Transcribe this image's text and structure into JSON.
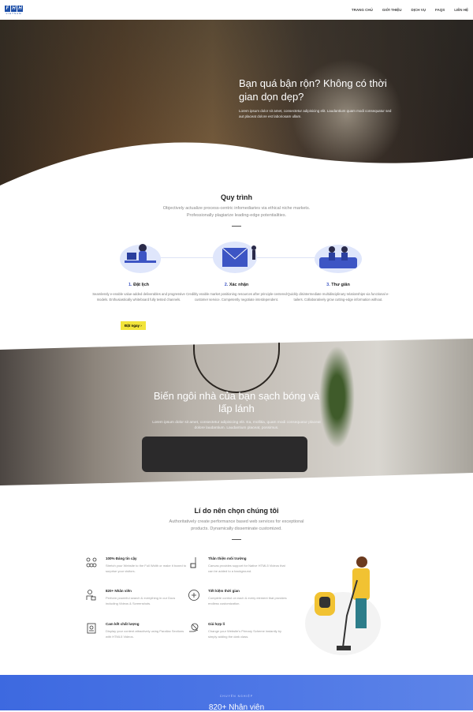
{
  "nav": {
    "logo_letters": [
      "F",
      "H",
      "H"
    ],
    "logo_sub": "VIETNAM",
    "items": [
      "TRANG CHỦ",
      "GIỚI THIỆU",
      "DỊCH VỤ",
      "FAQS",
      "LIÊN HỆ"
    ]
  },
  "hero": {
    "title": "Bạn quá bận rộn? Không có thời gian dọn dẹp?",
    "text": "Lorem ipsum dolor sit amet, consectetur adipisicing elit. Laudantium quam modi consequatur sed aut placeat dolore est laboriosam ullam."
  },
  "process": {
    "title": "Quy trình",
    "subtitle": "Objectively actualize process-centric infomediaries via ethical niche markets. Professionally plagiarize leading-edge potentialities.",
    "steps": [
      {
        "num": "1.",
        "label": "Đặt lịch",
        "text": "Seamlessly e-enable value-added deliverables and progressive models. Enthusiastically whiteboard fully tested channels."
      },
      {
        "num": "2.",
        "label": "Xác nhận",
        "text": "Credibly enable market positioning resources after principle-centered customer service. Competently negotiate interdependent."
      },
      {
        "num": "3.",
        "label": "Thư giãn",
        "text": "Quickly disintermediate multidisciplinary relationships via functional e-tailers. Collaboratively grow cutting-edge information without."
      }
    ],
    "button": "Đặt ngay"
  },
  "banner": {
    "title": "Biến ngôi nhà của bạn sạch bóng và lấp lánh",
    "text": "Lorem ipsum dolor sit amet, consectetur adipisicing elit. Ea, mollitia, quam modi consequatur placeat dolore laudantium. Laudantium placeat, possimus."
  },
  "reasons": {
    "title": "Lí do nên chọn chúng tôi",
    "subtitle": "Authoritatively create performance based web services for exceptional products. Dynamically disseminate customized.",
    "items": [
      {
        "icon": "team-icon",
        "title": "100% Đáng tin cậy",
        "text": "Stretch your Website to the Full Width or make it boxed to surprise your visitors."
      },
      {
        "icon": "vacuum-icon",
        "title": "Thân thiện môi trường",
        "text": "Canvas provides support for Native HTML5 Videos that can be added to a background."
      },
      {
        "icon": "staff-icon",
        "title": "820+ Nhân viên",
        "text": "Perform powerful search & everything in our Docs including Videos & Screenshots."
      },
      {
        "icon": "clock-icon",
        "title": "Tiết kiệm thời gian",
        "text": "Complete control on each & every element that provides endless customization."
      },
      {
        "icon": "certificate-icon",
        "title": "Cam kết chất lượng",
        "text": "Display your content attractively using Parallax Sections with HTML5 Videos."
      },
      {
        "icon": "price-icon",
        "title": "Giá hợp lí",
        "text": "Change your Website's Primary Scheme instantly by simply adding the dark class."
      }
    ]
  },
  "stats": {
    "label": "CHUYÊN NGHIỆP",
    "title": "820+ Nhân viên"
  },
  "colors": {
    "accent": "#3d55c4",
    "button": "#f2e43a",
    "band": "#4f78e6"
  }
}
